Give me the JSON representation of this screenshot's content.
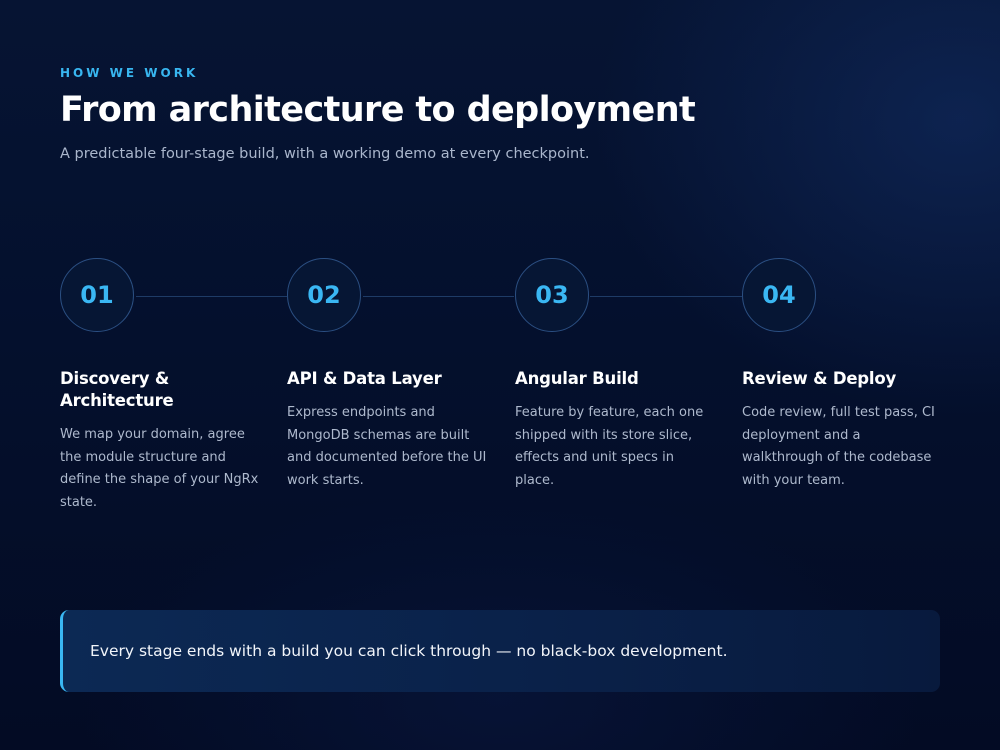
{
  "header": {
    "eyebrow": "HOW WE WORK",
    "title": "From architecture to deployment",
    "subtitle": "A predictable four-stage build, with a working demo at every checkpoint."
  },
  "steps": [
    {
      "number": "01",
      "title": "Discovery & Architecture",
      "description": "We map your domain, agree the module structure and define the shape of your NgRx state."
    },
    {
      "number": "02",
      "title": "API & Data Layer",
      "description": "Express endpoints and MongoDB schemas are built and documented before the UI work starts."
    },
    {
      "number": "03",
      "title": "Angular Build",
      "description": "Feature by feature, each one shipped with its store slice, effects and unit specs in place."
    },
    {
      "number": "04",
      "title": "Review & Deploy",
      "description": "Code review, full test pass, CI deployment and a walkthrough of the codebase with your team."
    }
  ],
  "callout": {
    "text": "Every stage ends with a build you can click through — no black-box development."
  },
  "colors": {
    "accent": "#3ab7f3",
    "background": "#04102d",
    "text_muted": "#aeb9cd"
  }
}
